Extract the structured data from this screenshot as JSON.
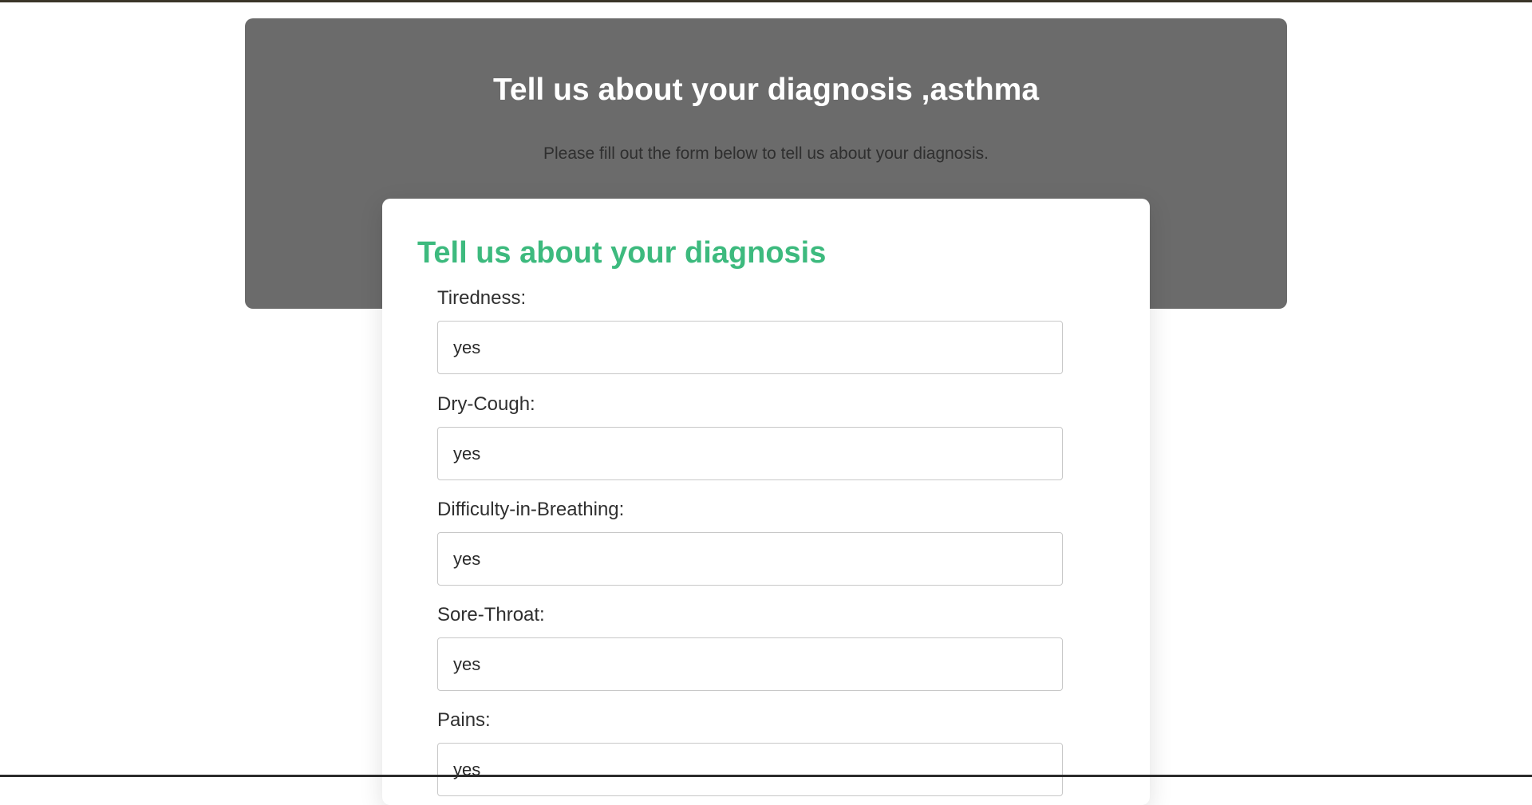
{
  "hero": {
    "title": "Tell us about your diagnosis ,asthma",
    "subtitle": "Please fill out the form below to tell us about your diagnosis."
  },
  "form": {
    "title": "Tell us about your diagnosis",
    "fields": [
      {
        "label": "Tiredness:",
        "value": "yes"
      },
      {
        "label": "Dry-Cough:",
        "value": "yes"
      },
      {
        "label": "Difficulty-in-Breathing:",
        "value": "yes"
      },
      {
        "label": "Sore-Throat:",
        "value": "yes"
      },
      {
        "label": "Pains:",
        "value": "yes"
      }
    ]
  },
  "colors": {
    "hero_background": "#6b6b6b",
    "form_title": "#3dba7e",
    "input_border": "#c8c8c8"
  }
}
